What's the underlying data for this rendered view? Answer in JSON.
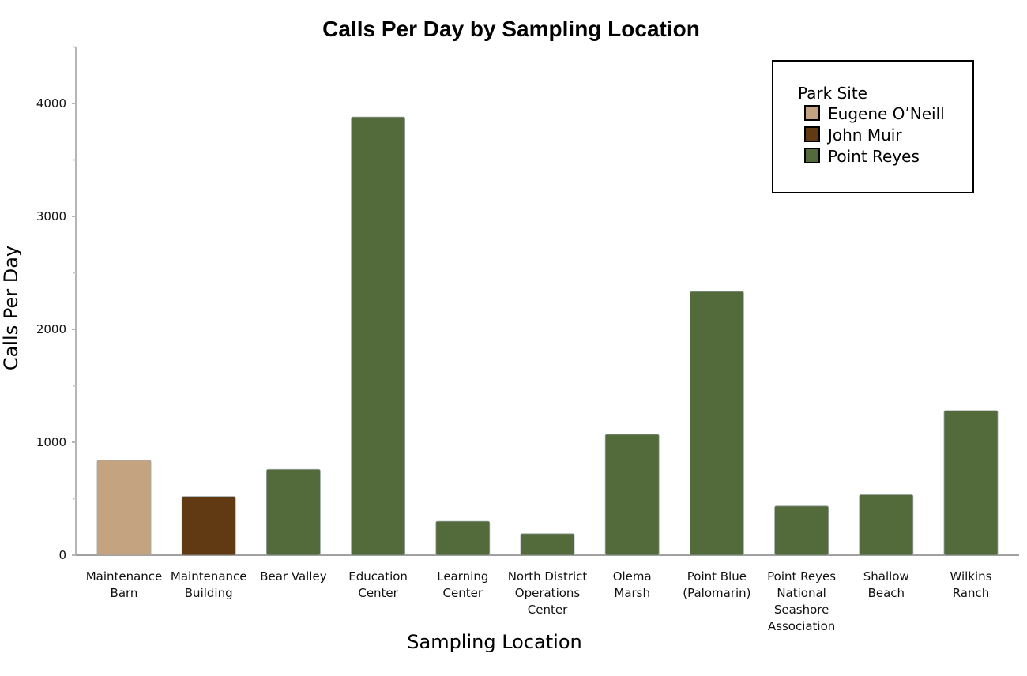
{
  "chart_data": {
    "type": "bar",
    "title": "Calls Per Day by Sampling Location",
    "xlabel": "Sampling Location",
    "ylabel": "Calls Per Day",
    "ylim": [
      0,
      4500
    ],
    "yticks": [
      0,
      1000,
      2000,
      3000,
      4000
    ],
    "yminor_ticks": [
      500,
      1500,
      2500,
      3500,
      4500
    ],
    "grid": false,
    "legend": {
      "title": "Park Site",
      "position": "top-right",
      "entries": [
        {
          "label": "Eugene O’Neill",
          "color": "#C4A381"
        },
        {
          "label": "John Muir",
          "color": "#613A14"
        },
        {
          "label": "Point Reyes",
          "color": "#536B3A"
        }
      ]
    },
    "categories": [
      [
        "Maintenance",
        "Barn"
      ],
      [
        "Maintenance",
        "Building"
      ],
      [
        "Bear Valley"
      ],
      [
        "Education",
        "Center"
      ],
      [
        "Learning",
        "Center"
      ],
      [
        "North District",
        "Operations",
        "Center"
      ],
      [
        "Olema",
        "Marsh"
      ],
      [
        "Point Blue",
        "(Palomarin)"
      ],
      [
        "Point Reyes",
        "National",
        "Seashore",
        "Association"
      ],
      [
        "Shallow",
        "Beach"
      ],
      [
        "Wilkins",
        "Ranch"
      ]
    ],
    "values": [
      840,
      520,
      760,
      3880,
      300,
      190,
      1070,
      2335,
      435,
      535,
      1280
    ],
    "groups": [
      "Eugene O’Neill",
      "John Muir",
      "Point Reyes",
      "Point Reyes",
      "Point Reyes",
      "Point Reyes",
      "Point Reyes",
      "Point Reyes",
      "Point Reyes",
      "Point Reyes",
      "Point Reyes"
    ]
  }
}
